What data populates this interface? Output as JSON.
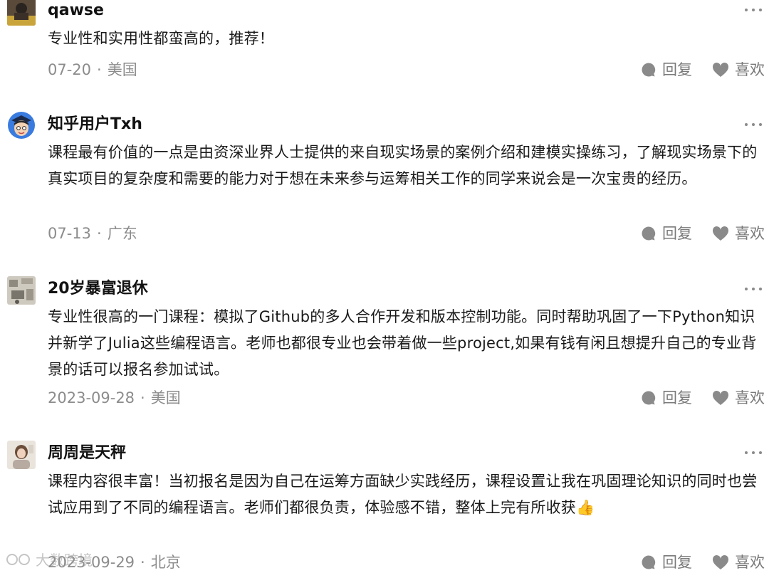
{
  "comments": [
    {
      "username": "qawse",
      "text": "专业性和实用性都蛮高的，推荐！",
      "date": "07-20",
      "location": "美国",
      "avatar_icon": "user-photo-dark",
      "reply_label": "回复",
      "like_label": "喜欢"
    },
    {
      "username": "知乎用户Txh",
      "text": "课程最有价值的一点是由资深业界人士提供的来自现实场景的案例介绍和建模实操练习，了解现实场景下的真实项目的复杂度和需要的能力对于想在未来参与运筹相关工作的同学来说会是一次宝贵的经历。",
      "date": "07-13",
      "location": "广东",
      "avatar_icon": "cartoon-graduate-avatar",
      "reply_label": "回复",
      "like_label": "喜欢"
    },
    {
      "username": "20岁暴富退休",
      "text": "专业性很高的一门课程：模拟了Github的多人合作开发和版本控制功能。同时帮助巩固了一下Python知识并新学了Julia这些编程语言。老师也都很专业也会带着做一些project,如果有钱有闲且想提升自己的专业背景的话可以报名参加试试。",
      "date": "2023-09-28",
      "location": "美国",
      "avatar_icon": "user-photo-gray",
      "reply_label": "回复",
      "like_label": "喜欢"
    },
    {
      "username": "周周是天秤",
      "text": "课程内容很丰富！当初报名是因为自己在运筹方面缺少实践经历，课程设置让我在巩固理论知识的同时也尝试应用到了不同的编程语言。老师们都很负责，体验感不错，整体上完有所收获👍",
      "date": "2023-09-29",
      "location": "北京",
      "avatar_icon": "user-photo-portrait",
      "reply_label": "回复",
      "like_label": "喜欢"
    }
  ],
  "watermark": "大数跨境",
  "colors": {
    "text": "#1a1a1a",
    "meta": "#8c8c8c",
    "action": "#7a7a7a",
    "icon": "#8a8a8a"
  }
}
